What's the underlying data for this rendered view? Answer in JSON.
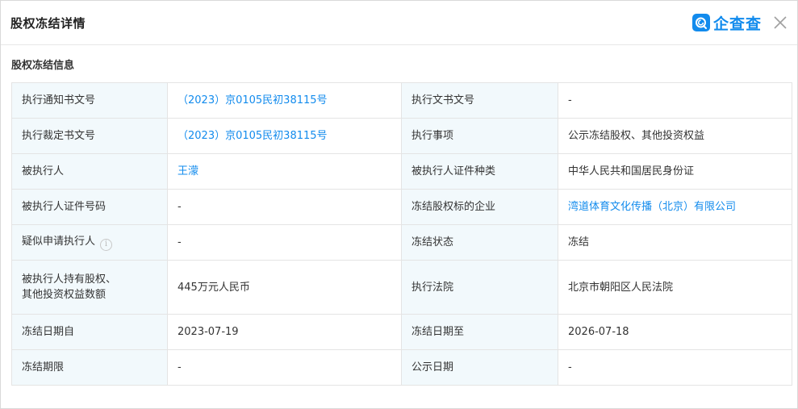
{
  "header": {
    "title": "股权冻结详情",
    "brand": "企查查",
    "brand_color": "#128bed"
  },
  "section": {
    "title": "股权冻结信息"
  },
  "rows": [
    {
      "l1": "执行通知书文号",
      "v1": "（2023）京0105民初38115号",
      "l2": "执行文书文号",
      "v2": "-"
    },
    {
      "l1": "执行裁定书文号",
      "v1": "（2023）京0105民初38115号",
      "l2": "执行事项",
      "v2": "公示冻结股权、其他投资权益"
    },
    {
      "l1": "被执行人",
      "v1": "王濛",
      "l2": "被执行人证件种类",
      "v2": "中华人民共和国居民身份证"
    },
    {
      "l1": "被执行人证件号码",
      "v1": "-",
      "l2": "冻结股权标的企业",
      "v2": "湾道体育文化传播（北京）有限公司"
    },
    {
      "l1": "疑似申请执行人",
      "v1": "-",
      "l2": "冻结状态",
      "v2": "冻结"
    },
    {
      "l1a": "被执行人持有股权、",
      "l1b": "其他投资权益数额",
      "v1": "445万元人民币",
      "l2": "执行法院",
      "v2": "北京市朝阳区人民法院"
    },
    {
      "l1": "冻结日期自",
      "v1": "2023-07-19",
      "l2": "冻结日期至",
      "v2": "2026-07-18"
    },
    {
      "l1": "冻结期限",
      "v1": "-",
      "l2": "公示日期",
      "v2": "-"
    }
  ]
}
